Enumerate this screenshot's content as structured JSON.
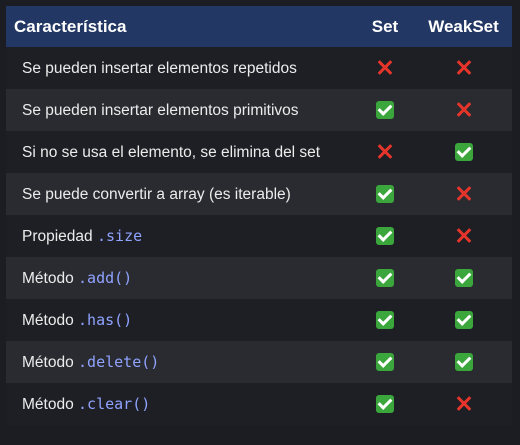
{
  "header": {
    "feature": "Característica",
    "set": "Set",
    "weakset": "WeakSet"
  },
  "rows": [
    {
      "text": "Se pueden insertar elementos repetidos",
      "code": "",
      "set": "no",
      "weakset": "no"
    },
    {
      "text": "Se pueden insertar elementos primitivos",
      "code": "",
      "set": "yes",
      "weakset": "no"
    },
    {
      "text": "Si no se usa el elemento, se elimina del set",
      "code": "",
      "set": "no",
      "weakset": "yes"
    },
    {
      "text": "Se puede convertir a array (es iterable)",
      "code": "",
      "set": "yes",
      "weakset": "no"
    },
    {
      "text": "Propiedad ",
      "code": ".size",
      "set": "yes",
      "weakset": "no"
    },
    {
      "text": "Método ",
      "code": ".add()",
      "set": "yes",
      "weakset": "yes"
    },
    {
      "text": "Método ",
      "code": ".has()",
      "set": "yes",
      "weakset": "yes"
    },
    {
      "text": "Método ",
      "code": ".delete()",
      "set": "yes",
      "weakset": "yes"
    },
    {
      "text": "Método ",
      "code": ".clear()",
      "set": "yes",
      "weakset": "no"
    }
  ],
  "icons": {
    "yes": "check-mark-icon",
    "no": "cross-mark-icon"
  },
  "colors": {
    "header_bg": "#223763",
    "check": "#3aa63b",
    "cross": "#e5352b",
    "code_text": "#8fa3ff"
  }
}
